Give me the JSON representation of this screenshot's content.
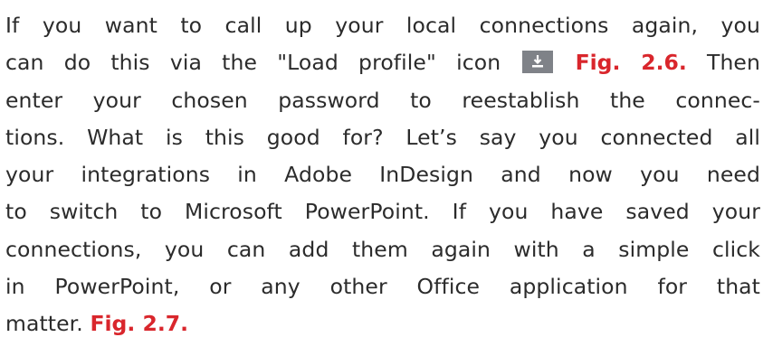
{
  "paragraph": {
    "line1": " If you want to call up your local connections again, you",
    "line2_before": "can do this via the \"Load profile\" icon",
    "icon": "download-icon",
    "fig_ref_1": "Fig. 2.6.",
    "line2_after": "Then",
    "line3": "enter your chosen password to reestablish the connec-",
    "line4": "tions. What is this good for? Let’s say you connected all",
    "line5": "your integrations in Adobe InDesign and now you need",
    "line6": "to switch to Microsoft PowerPoint. If you have saved your",
    "line7": "connections, you can add them again with a simple click",
    "line8": "in PowerPoint, or any other Office application for that",
    "line9": "matter.",
    "fig_ref_2": "Fig. 2.7."
  },
  "colors": {
    "text": "#2b2b2b",
    "figure_ref": "#d9262c",
    "icon_bg": "#7f8288"
  }
}
